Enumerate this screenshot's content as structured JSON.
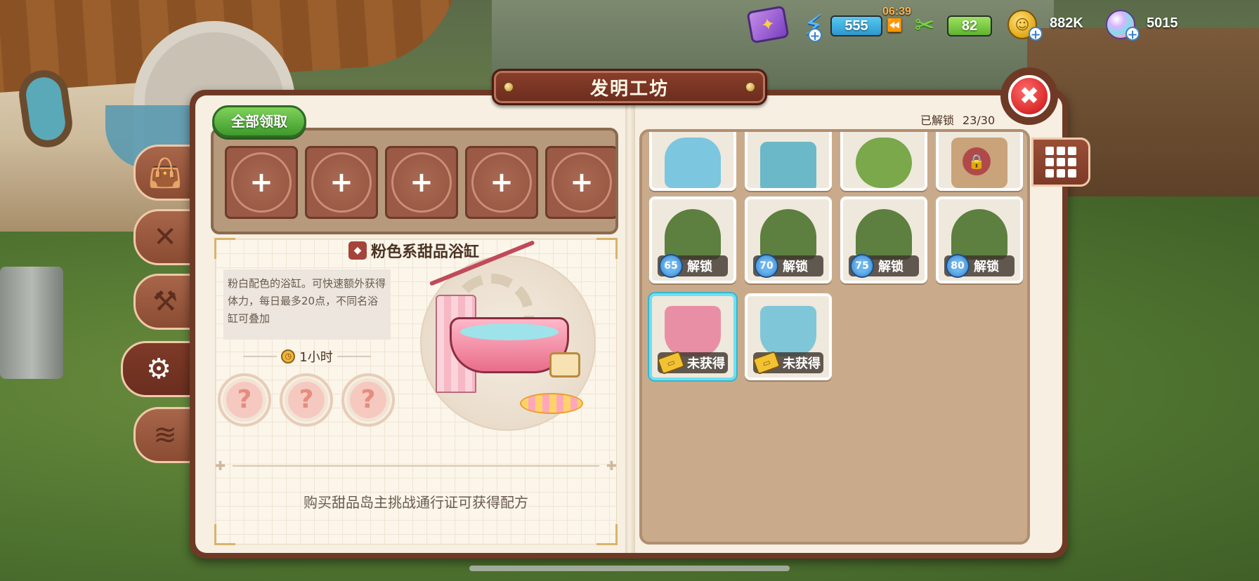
{
  "hud": {
    "energy_value": "555",
    "timer": "06:39",
    "food_value": "82",
    "coins": "882K",
    "gems": "5015"
  },
  "panel": {
    "title": "发明工坊",
    "close_symbol": "✖"
  },
  "left_page": {
    "claim_all_label": "全部领取",
    "slots": [
      "+",
      "+",
      "+",
      "+",
      "+"
    ],
    "item_name": "粉色系甜品浴缸",
    "description": "粉白配色的浴缸。可快速额外获得体力，每日最多20点，不同名浴缸可叠加",
    "craft_time": "1小时",
    "materials": [
      "?",
      "?",
      "?"
    ],
    "hint": "购买甜品岛主挑战通行证可获得配方"
  },
  "right_page": {
    "unlocked_label": "已解锁",
    "unlocked_count": "23/30",
    "row1": [
      {
        "name": "toilet",
        "art_color": "#7cc6e0"
      },
      {
        "name": "treadmill",
        "art_color": "#6ab8c8"
      },
      {
        "name": "fruit-robot",
        "art_color": "#7aa84a"
      },
      {
        "name": "locked-bag",
        "art_color": "#c9a37a"
      }
    ],
    "row2": [
      {
        "level": "65",
        "label": "解锁",
        "fruit_color": "#d7c24a"
      },
      {
        "level": "70",
        "label": "解锁",
        "fruit_color": "#d7c24a"
      },
      {
        "level": "75",
        "label": "解锁",
        "fruit_color": "#d03a3a"
      },
      {
        "level": "80",
        "label": "解锁",
        "fruit_color": "#4a6ad0"
      }
    ],
    "row3": [
      {
        "label": "未获得",
        "tint": "#e98fa5"
      },
      {
        "label": "未获得",
        "tint": "#7fc7d8"
      }
    ]
  },
  "side_tabs": [
    "bag-icon",
    "fork-knife-icon",
    "hammer-icon",
    "lightbulb-gear-icon",
    "dna-icon"
  ],
  "colors": {
    "frame": "#6e3a26",
    "claim_green": "#3e9a2b",
    "selected_cyan": "#6fe0f0"
  }
}
